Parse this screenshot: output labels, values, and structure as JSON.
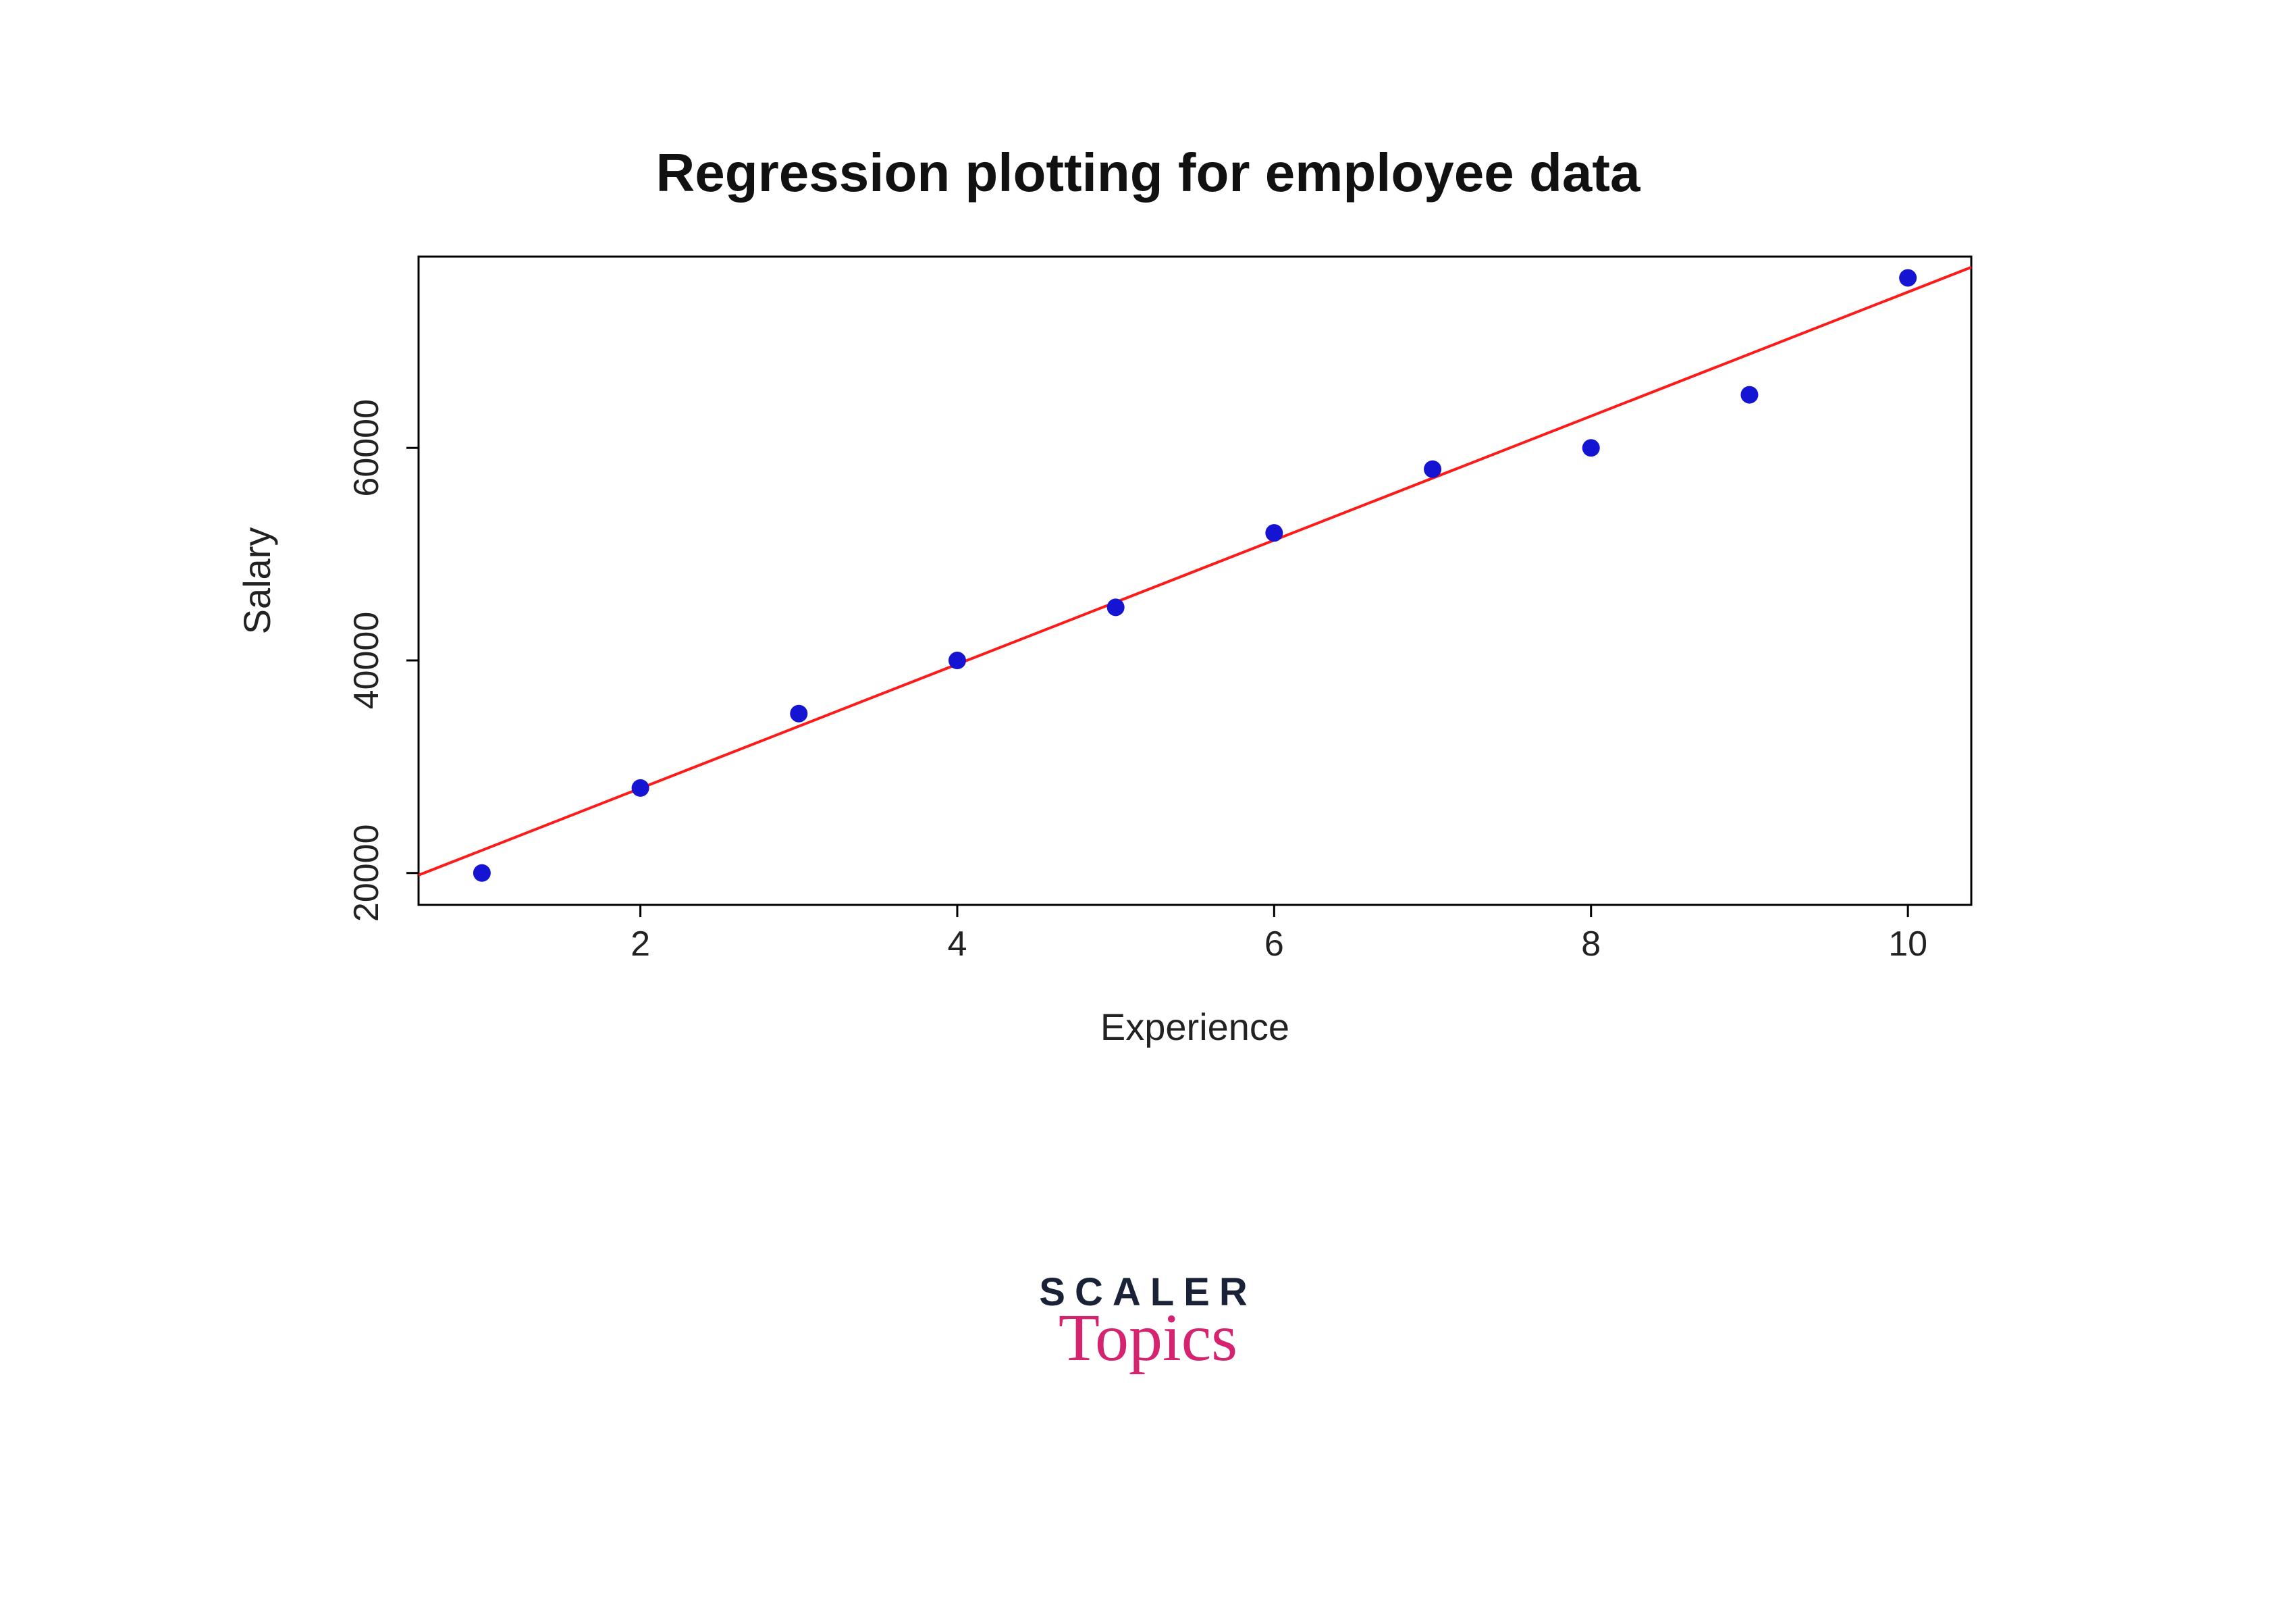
{
  "title": "Regression plotting for employee data",
  "logo": {
    "line1": "SCALER",
    "line2": "Topics"
  },
  "chart_data": {
    "type": "scatter",
    "title": "Regression plotting for employee data",
    "xlabel": "Experience",
    "ylabel": "Salary",
    "x": [
      1,
      2,
      3,
      4,
      5,
      6,
      7,
      8,
      9,
      10
    ],
    "y": [
      20000,
      28000,
      35000,
      40000,
      45000,
      52000,
      58000,
      60000,
      65000,
      76000
    ],
    "regression_line": {
      "x": [
        0.6,
        10.4
      ],
      "y": [
        19800,
        77000
      ],
      "color": "#ff1a1a"
    },
    "point_color": "#1414d2",
    "xticks": [
      2,
      4,
      6,
      8,
      10
    ],
    "yticks": [
      20000,
      40000,
      60000
    ],
    "xlim": [
      0.6,
      10.4
    ],
    "ylim": [
      17000,
      78000
    ],
    "grid": false
  }
}
